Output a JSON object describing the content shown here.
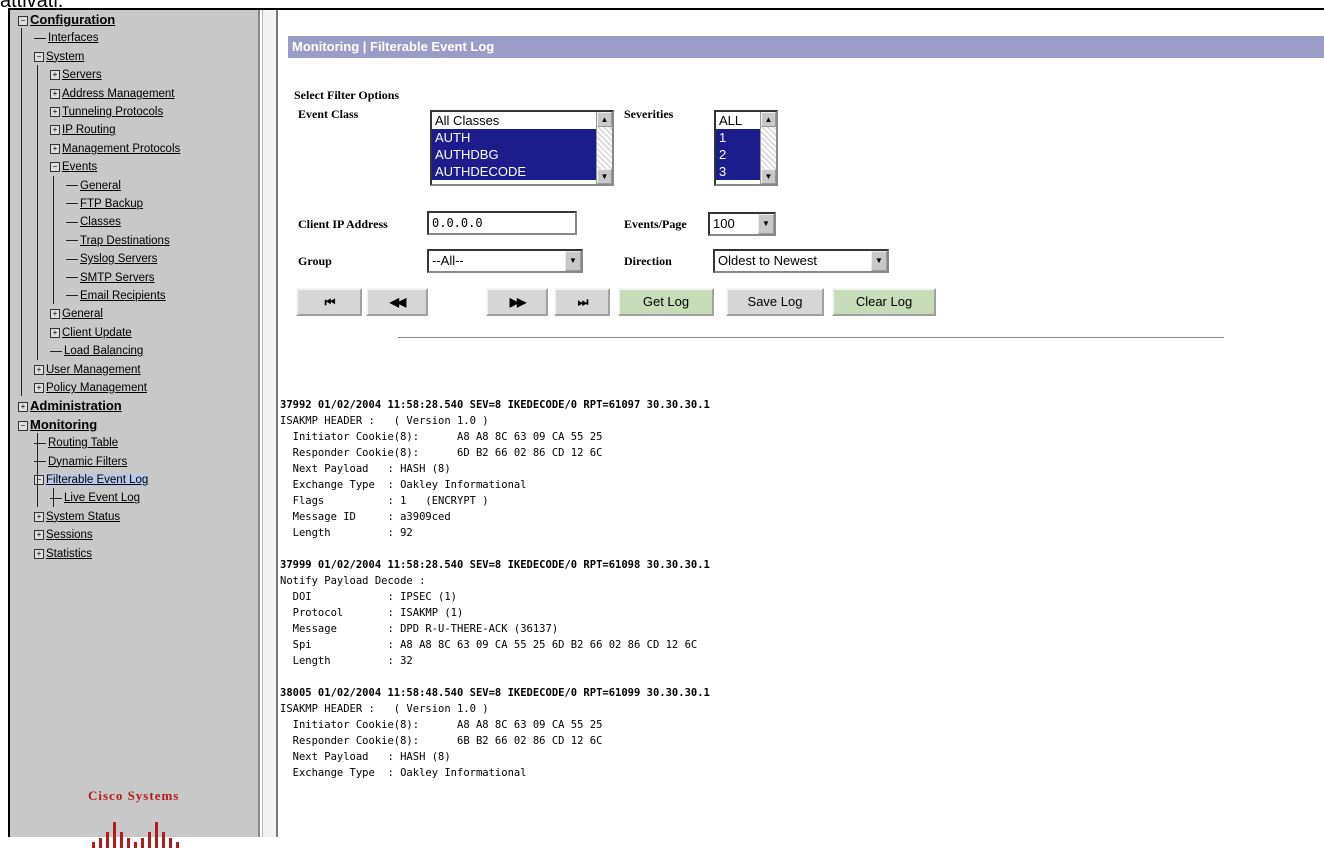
{
  "page_caption_cut": "attivati.",
  "nav": {
    "items": [
      {
        "label": "Configuration",
        "level": 0,
        "box": "−",
        "bold": true
      },
      {
        "label": "Interfaces",
        "level": 1,
        "box": ""
      },
      {
        "label": "System",
        "level": 1,
        "box": "−"
      },
      {
        "label": "Servers",
        "level": 2,
        "box": "+"
      },
      {
        "label": "Address Management",
        "level": 2,
        "box": "+"
      },
      {
        "label": "Tunneling Protocols",
        "level": 2,
        "box": "+"
      },
      {
        "label": "IP Routing",
        "level": 2,
        "box": "+"
      },
      {
        "label": "Management Protocols",
        "level": 2,
        "box": "+"
      },
      {
        "label": "Events",
        "level": 2,
        "box": "−"
      },
      {
        "label": "General",
        "level": 3,
        "box": ""
      },
      {
        "label": "FTP Backup",
        "level": 3,
        "box": ""
      },
      {
        "label": "Classes",
        "level": 3,
        "box": ""
      },
      {
        "label": "Trap Destinations",
        "level": 3,
        "box": ""
      },
      {
        "label": "Syslog Servers",
        "level": 3,
        "box": ""
      },
      {
        "label": "SMTP Servers",
        "level": 3,
        "box": ""
      },
      {
        "label": "Email Recipients",
        "level": 3,
        "box": ""
      },
      {
        "label": "General",
        "level": 2,
        "box": "+"
      },
      {
        "label": "Client Update",
        "level": 2,
        "box": "+"
      },
      {
        "label": "Load Balancing",
        "level": 2,
        "box": ""
      },
      {
        "label": "User Management",
        "level": 1,
        "box": "+"
      },
      {
        "label": "Policy Management",
        "level": 1,
        "box": "+"
      },
      {
        "label": "Administration",
        "level": 0,
        "box": "+",
        "bold": true
      },
      {
        "label": "Monitoring",
        "level": 0,
        "box": "−",
        "bold": true
      },
      {
        "label": "Routing Table",
        "level": 1,
        "box": ""
      },
      {
        "label": "Dynamic Filters",
        "level": 1,
        "box": ""
      },
      {
        "label": "Filterable Event Log",
        "level": 1,
        "box": "−",
        "selected": true
      },
      {
        "label": "Live Event Log",
        "level": 2,
        "box": ""
      },
      {
        "label": "System Status",
        "level": 1,
        "box": "+"
      },
      {
        "label": "Sessions",
        "level": 1,
        "box": "+"
      },
      {
        "label": "Statistics",
        "level": 1,
        "box": "+"
      }
    ],
    "logo_text": "Cisco Systems"
  },
  "header": {
    "title": "Monitoring | Filterable Event Log"
  },
  "filter": {
    "section_label": "Select Filter Options",
    "event_class_label": "Event Class",
    "event_class_options": [
      {
        "label": "All Classes",
        "selected": false
      },
      {
        "label": "AUTH",
        "selected": true
      },
      {
        "label": "AUTHDBG",
        "selected": true
      },
      {
        "label": "AUTHDECODE",
        "selected": true
      }
    ],
    "severities_label": "Severities",
    "severity_options": [
      {
        "label": "ALL",
        "selected": false
      },
      {
        "label": "1",
        "selected": true
      },
      {
        "label": "2",
        "selected": true
      },
      {
        "label": "3",
        "selected": true
      }
    ],
    "client_ip_label": "Client IP Address",
    "client_ip_value": "0.0.0.0",
    "events_per_page_label": "Events/Page",
    "events_per_page_value": "100",
    "group_label": "Group",
    "group_value": "--All--",
    "direction_label": "Direction",
    "direction_value": "Oldest to Newest"
  },
  "buttons": {
    "first": "⏮",
    "prev": "◀◀",
    "next": "▶▶",
    "last": "⏭",
    "get_log": "Get Log",
    "save_log": "Save Log",
    "clear_log": "Clear Log"
  },
  "log_entries": [
    {
      "header": "37992 01/02/2004 11:58:28.540 SEV=8 IKEDECODE/0 RPT=61097 30.30.30.1",
      "lines": [
        "ISAKMP HEADER :   ( Version 1.0 )",
        "  Initiator Cookie(8):      A8 A8 8C 63 09 CA 55 25",
        "  Responder Cookie(8):      6D B2 66 02 86 CD 12 6C",
        "  Next Payload   : HASH (8)",
        "  Exchange Type  : Oakley Informational",
        "  Flags          : 1   (ENCRYPT )",
        "  Message ID     : a3909ced",
        "  Length         : 92"
      ]
    },
    {
      "header": "37999 01/02/2004 11:58:28.540 SEV=8 IKEDECODE/0 RPT=61098 30.30.30.1",
      "lines": [
        "Notify Payload Decode :",
        "  DOI            : IPSEC (1)",
        "  Protocol       : ISAKMP (1)",
        "  Message        : DPD R-U-THERE-ACK (36137)",
        "  Spi            : A8 A8 8C 63 09 CA 55 25 6D B2 66 02 86 CD 12 6C",
        "  Length         : 32"
      ]
    },
    {
      "header": "38005 01/02/2004 11:58:48.540 SEV=8 IKEDECODE/0 RPT=61099 30.30.30.1",
      "lines": [
        "ISAKMP HEADER :   ( Version 1.0 )",
        "  Initiator Cookie(8):      A8 A8 8C 63 09 CA 55 25",
        "  Responder Cookie(8):      6B B2 66 02 86 CD 12 6C",
        "  Next Payload   : HASH (8)",
        "  Exchange Type  : Oakley Informational"
      ]
    }
  ]
}
